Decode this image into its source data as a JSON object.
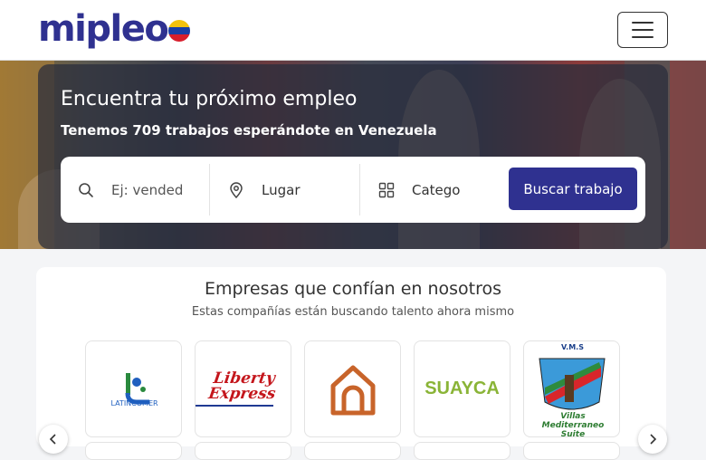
{
  "header": {
    "logo_text": "mipleo",
    "menu_icon": "hamburger-icon",
    "flag_colors": [
      "#f4c20d",
      "#1a3fa6",
      "#d81e2c"
    ]
  },
  "hero": {
    "title": "Encuentra tu próximo empleo",
    "subtitle": "Tenemos 709 trabajos esperándote en Venezuela"
  },
  "search": {
    "keyword_placeholder": "Ej: vended",
    "location_label": "Lugar",
    "category_label": "Catego",
    "button_label": "Buscar trabajo",
    "keyword_icon": "search-icon",
    "location_icon": "map-pin-icon",
    "category_icon": "grid-icon"
  },
  "companies": {
    "title": "Empresas que confían en nosotros",
    "subtitle": "Estas compañías están buscando talento ahora mismo",
    "logos": [
      {
        "name": "LATINCOMER"
      },
      {
        "name": "Liberty Express"
      },
      {
        "name": "house-logo"
      },
      {
        "name": "SUAYCA"
      },
      {
        "name": "V.M.S Villas Mediterraneo Suite",
        "line1": "V.M.S",
        "line2": "Villas",
        "line3": "Mediterraneo",
        "line4": "Suite"
      }
    ],
    "prev_icon": "chevron-left-icon",
    "next_icon": "chevron-right-icon"
  },
  "colors": {
    "brand": "#2f3190",
    "accent_orange": "#c8642a"
  }
}
